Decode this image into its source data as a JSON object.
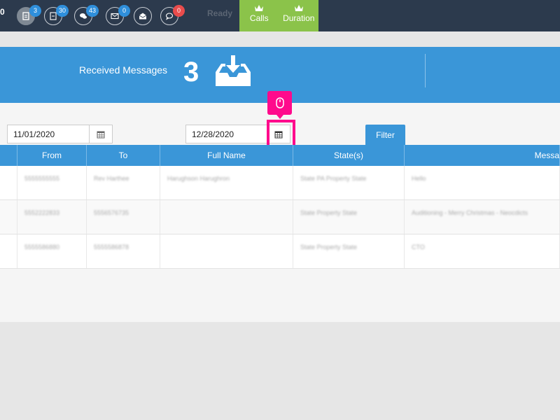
{
  "topbar": {
    "edge_text": "0",
    "badges": [
      "3",
      "30",
      "43",
      "0",
      "0"
    ],
    "status": "Ready",
    "tabs": [
      {
        "label": "Calls"
      },
      {
        "label": "Duration"
      }
    ]
  },
  "banner": {
    "label": "Received Messages",
    "count": "3"
  },
  "filters": {
    "start_date": "11/01/2020",
    "end_date": "12/28/2020",
    "filter_label": "Filter"
  },
  "table": {
    "columns": [
      "",
      "From",
      "To",
      "Full Name",
      "State(s)",
      "Messa"
    ],
    "rows": [
      [
        "",
        "5555555555",
        "Rev Harthee",
        "Harughson Harughron",
        "State PA Property State",
        "Hello"
      ],
      [
        "",
        "5552222833",
        "5556576735",
        "",
        "State Property State",
        "Auditioning - Merry Christmas - Neocdicts"
      ],
      [
        "",
        "5555586880",
        "5555586878",
        "",
        "State Property State",
        "CTO"
      ]
    ]
  },
  "colors": {
    "accent": "#3a96d8",
    "topbar": "#2c3a4d",
    "green": "#8bc34a",
    "highlight": "#ff0a8c"
  }
}
